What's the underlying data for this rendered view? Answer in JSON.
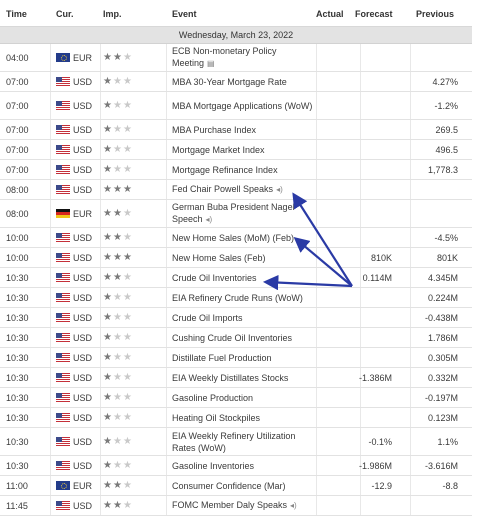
{
  "header": {
    "time": "Time",
    "currency": "Cur.",
    "importance": "Imp.",
    "event": "Event",
    "actual": "Actual",
    "forecast": "Forecast",
    "previous": "Previous"
  },
  "date_label": "Wednesday, March 23, 2022",
  "colors": {
    "arrow": "#2a3aa5",
    "date_row_bg": "#e3e3e3"
  },
  "rows": [
    {
      "time": "04:00",
      "flag": "eur",
      "cur": "EUR",
      "stars": 2,
      "event": "ECB Non-monetary Policy Meeting",
      "icon": "document-icon",
      "actual": "",
      "forecast": "",
      "previous": ""
    },
    {
      "time": "07:00",
      "flag": "usa",
      "cur": "USD",
      "stars": 1,
      "event": "MBA 30-Year Mortgage Rate",
      "icon": "",
      "actual": "",
      "forecast": "",
      "previous": "4.27%"
    },
    {
      "time": "07:00",
      "flag": "usa",
      "cur": "USD",
      "stars": 1,
      "event": "MBA Mortgage Applications (WoW)",
      "icon": "",
      "actual": "",
      "forecast": "",
      "previous": "-1.2%"
    },
    {
      "time": "07:00",
      "flag": "usa",
      "cur": "USD",
      "stars": 1,
      "event": "MBA Purchase Index",
      "icon": "",
      "actual": "",
      "forecast": "",
      "previous": "269.5"
    },
    {
      "time": "07:00",
      "flag": "usa",
      "cur": "USD",
      "stars": 1,
      "event": "Mortgage Market Index",
      "icon": "",
      "actual": "",
      "forecast": "",
      "previous": "496.5"
    },
    {
      "time": "07:00",
      "flag": "usa",
      "cur": "USD",
      "stars": 1,
      "event": "Mortgage Refinance Index",
      "icon": "",
      "actual": "",
      "forecast": "",
      "previous": "1,778.3"
    },
    {
      "time": "08:00",
      "flag": "usa",
      "cur": "USD",
      "stars": 3,
      "event": "Fed Chair Powell Speaks",
      "icon": "speaker-icon",
      "actual": "",
      "forecast": "",
      "previous": ""
    },
    {
      "time": "08:00",
      "flag": "ger",
      "cur": "EUR",
      "stars": 2,
      "event": "German Buba President Nagel Speech",
      "icon": "speaker-icon",
      "actual": "",
      "forecast": "",
      "previous": ""
    },
    {
      "time": "10:00",
      "flag": "usa",
      "cur": "USD",
      "stars": 2,
      "event": "New Home Sales (MoM) (Feb)",
      "icon": "",
      "actual": "",
      "forecast": "",
      "previous": "-4.5%"
    },
    {
      "time": "10:00",
      "flag": "usa",
      "cur": "USD",
      "stars": 3,
      "event": "New Home Sales (Feb)",
      "icon": "",
      "actual": "",
      "forecast": "810K",
      "previous": "801K"
    },
    {
      "time": "10:30",
      "flag": "usa",
      "cur": "USD",
      "stars": 2,
      "event": "Crude Oil Inventories",
      "icon": "",
      "actual": "",
      "forecast": "0.114M",
      "previous": "4.345M"
    },
    {
      "time": "10:30",
      "flag": "usa",
      "cur": "USD",
      "stars": 1,
      "event": "EIA Refinery Crude Runs (WoW)",
      "icon": "",
      "actual": "",
      "forecast": "",
      "previous": "0.224M"
    },
    {
      "time": "10:30",
      "flag": "usa",
      "cur": "USD",
      "stars": 1,
      "event": "Crude Oil Imports",
      "icon": "",
      "actual": "",
      "forecast": "",
      "previous": "-0.438M"
    },
    {
      "time": "10:30",
      "flag": "usa",
      "cur": "USD",
      "stars": 1,
      "event": "Cushing Crude Oil Inventories",
      "icon": "",
      "actual": "",
      "forecast": "",
      "previous": "1.786M"
    },
    {
      "time": "10:30",
      "flag": "usa",
      "cur": "USD",
      "stars": 1,
      "event": "Distillate Fuel Production",
      "icon": "",
      "actual": "",
      "forecast": "",
      "previous": "0.305M"
    },
    {
      "time": "10:30",
      "flag": "usa",
      "cur": "USD",
      "stars": 1,
      "event": "EIA Weekly Distillates Stocks",
      "icon": "",
      "actual": "",
      "forecast": "-1.386M",
      "previous": "0.332M"
    },
    {
      "time": "10:30",
      "flag": "usa",
      "cur": "USD",
      "stars": 1,
      "event": "Gasoline Production",
      "icon": "",
      "actual": "",
      "forecast": "",
      "previous": "-0.197M"
    },
    {
      "time": "10:30",
      "flag": "usa",
      "cur": "USD",
      "stars": 1,
      "event": "Heating Oil Stockpiles",
      "icon": "",
      "actual": "",
      "forecast": "",
      "previous": "0.123M"
    },
    {
      "time": "10:30",
      "flag": "usa",
      "cur": "USD",
      "stars": 1,
      "event": "EIA Weekly Refinery Utilization Rates (WoW)",
      "icon": "",
      "actual": "",
      "forecast": "-0.1%",
      "previous": "1.1%"
    },
    {
      "time": "10:30",
      "flag": "usa",
      "cur": "USD",
      "stars": 1,
      "event": "Gasoline Inventories",
      "icon": "",
      "actual": "",
      "forecast": "-1.986M",
      "previous": "-3.616M"
    },
    {
      "time": "11:00",
      "flag": "eur",
      "cur": "EUR",
      "stars": 2,
      "event": "Consumer Confidence (Mar)",
      "icon": "",
      "actual": "",
      "forecast": "-12.9",
      "previous": "-8.8"
    },
    {
      "time": "11:45",
      "flag": "usa",
      "cur": "USD",
      "stars": 2,
      "event": "FOMC Member Daly Speaks",
      "icon": "speaker-icon",
      "actual": "",
      "forecast": "",
      "previous": ""
    }
  ]
}
